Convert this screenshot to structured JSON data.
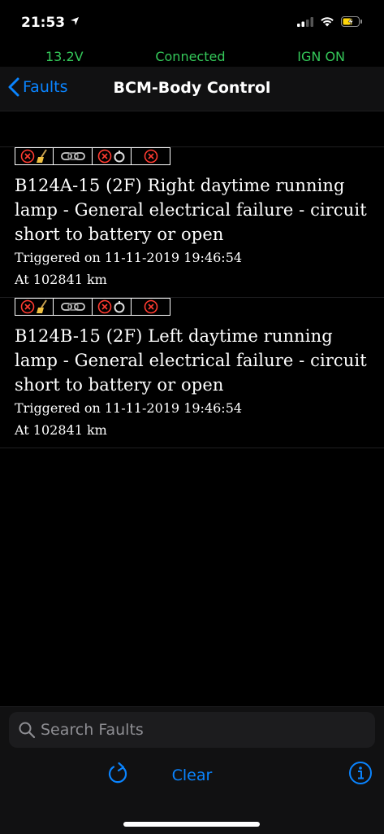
{
  "status": {
    "time": "21:53"
  },
  "info_bar": {
    "voltage": "13.2V",
    "connection": "Connected",
    "ignition": "IGN ON"
  },
  "nav": {
    "back_label": "Faults",
    "title": "BCM-Body Control"
  },
  "faults": [
    {
      "title": "B124A-15 (2F) Right daytime running lamp - General electrical failure - circuit short to battery or open",
      "triggered": "Triggered on 11-11-2019 19:46:54",
      "odometer": "At 102841 km"
    },
    {
      "title": "B124B-15 (2F) Left daytime running lamp - General electrical failure - circuit short to battery or open",
      "triggered": "Triggered on 11-11-2019 19:46:54",
      "odometer": "At 102841 km"
    }
  ],
  "fault_icon_names": [
    "error-clear-icon",
    "chain-link-icon",
    "error-reset-icon",
    "error-icon"
  ],
  "search": {
    "placeholder": "Search Faults",
    "value": ""
  },
  "toolbar": {
    "clear_label": "Clear"
  },
  "colors": {
    "accent": "#0a84ff",
    "status_green": "#34c759",
    "error_red": "#ff3b30",
    "background": "#000000",
    "bar_background": "#111112"
  }
}
